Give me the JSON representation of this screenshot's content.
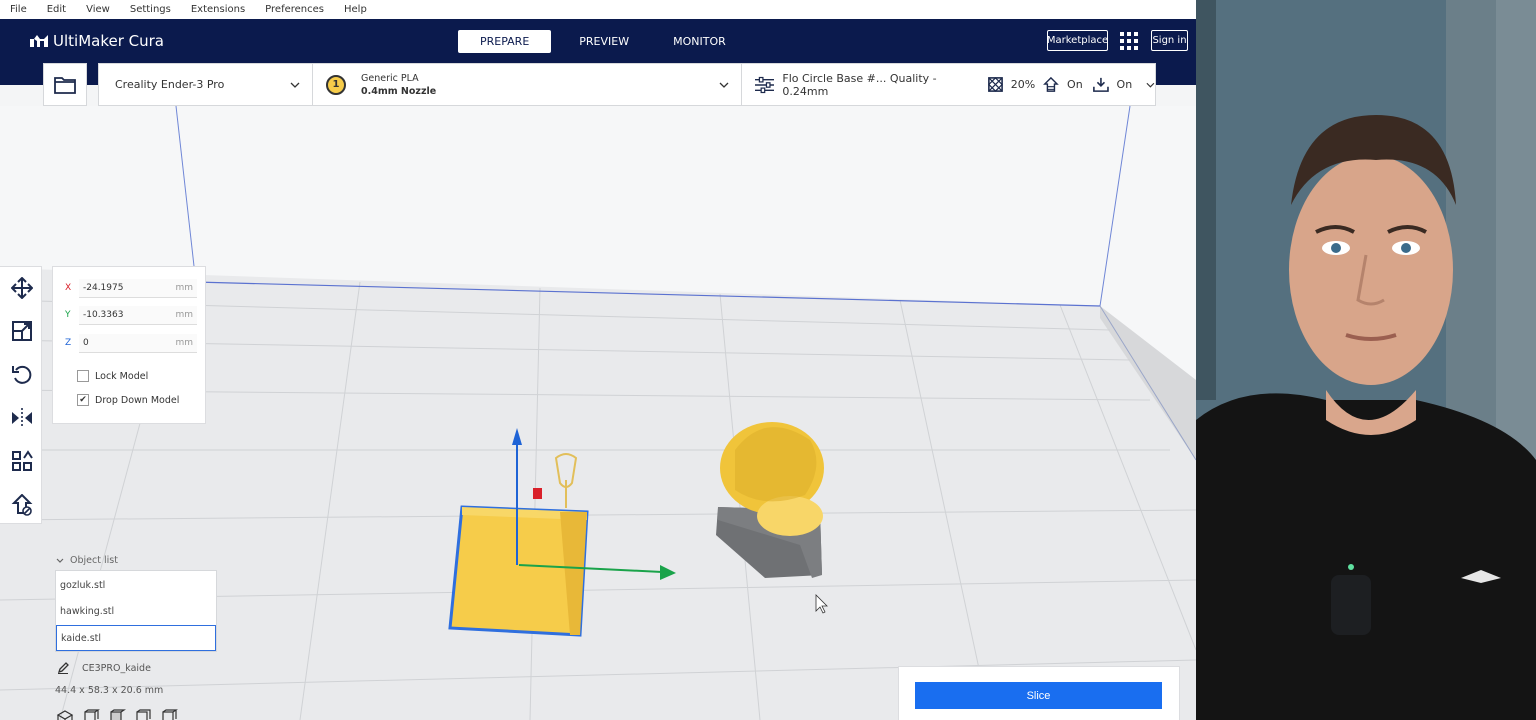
{
  "menu": [
    "File",
    "Edit",
    "View",
    "Settings",
    "Extensions",
    "Preferences",
    "Help"
  ],
  "header": {
    "logo": "UltiMaker Cura",
    "tabs": [
      "PREPARE",
      "PREVIEW",
      "MONITOR"
    ],
    "marketplace": "Marketplace",
    "sign_in": "Sign in"
  },
  "config": {
    "printer": "Creality Ender-3 Pro",
    "extruder_number": "1",
    "material": "Generic PLA",
    "nozzle": "0.4mm Nozzle",
    "profile": "Flo Circle Base #... Quality - 0.24mm",
    "infill": "20%",
    "support": "On",
    "adhesion": "On"
  },
  "move_panel": {
    "x_label": "X",
    "x_value": "-24.1975",
    "y_label": "Y",
    "y_value": "-10.3363",
    "z_label": "Z",
    "z_value": "0",
    "unit": "mm",
    "lock_model": "Lock Model",
    "lock_checked": false,
    "drop_down": "Drop Down Model",
    "drop_checked": true,
    "check_glyph": "✔"
  },
  "object_list": {
    "title": "Object list",
    "items": [
      "gozluk.stl",
      "hawking.stl",
      "kaide.stl"
    ],
    "selected": "kaide.stl",
    "job_name": "CE3PRO_kaide",
    "dimensions": "44.4 x 58.3 x 20.6 mm"
  },
  "slice_button": "Slice",
  "colors": {
    "header_bg": "#0b1a4d",
    "accent_blue": "#196ef0",
    "model_yellow": "#f6cc4a",
    "axis_red": "#d9202a",
    "axis_green": "#1aa34a",
    "axis_blue": "#1e63d6"
  },
  "icons": {
    "folder": "folder-icon",
    "chevron": "chevron-down-icon",
    "settings": "sliders-icon",
    "infill": "infill-icon",
    "support": "support-icon",
    "adhesion": "adhesion-icon",
    "move": "move-icon",
    "scale": "scale-icon",
    "rotate": "rotate-icon",
    "mirror": "mirror-icon",
    "per_model": "per-model-settings-icon",
    "support_blocker": "support-blocker-icon",
    "edit": "pencil-icon"
  }
}
